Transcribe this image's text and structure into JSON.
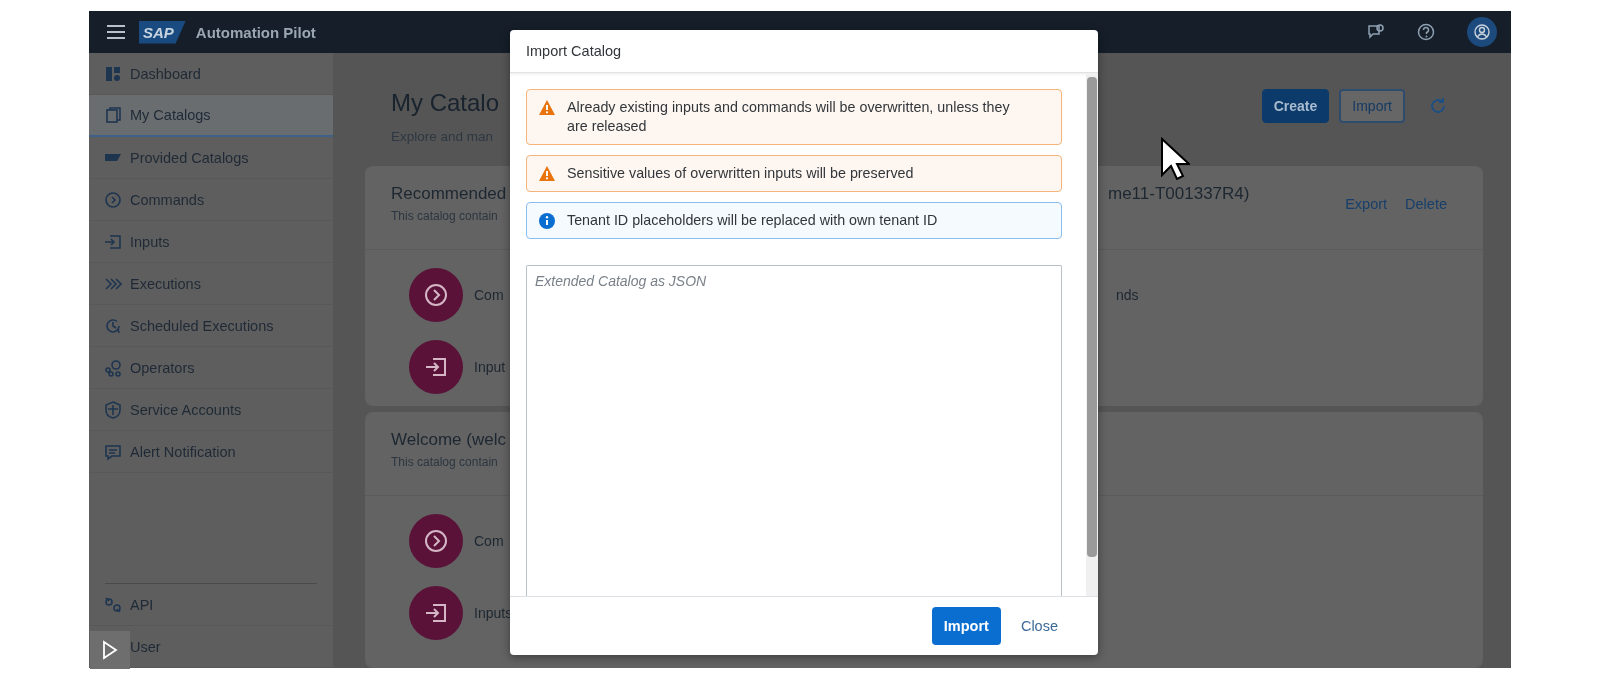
{
  "shell": {
    "logo": "SAP",
    "title": "Automation Pilot"
  },
  "sidebar": {
    "items": [
      {
        "label": "Dashboard",
        "selected": false
      },
      {
        "label": "My Catalogs",
        "selected": true
      },
      {
        "label": "Provided Catalogs",
        "selected": false
      },
      {
        "label": "Commands",
        "selected": false
      },
      {
        "label": "Inputs",
        "selected": false
      },
      {
        "label": "Executions",
        "selected": false
      },
      {
        "label": "Scheduled Executions",
        "selected": false
      },
      {
        "label": "Operators",
        "selected": false
      },
      {
        "label": "Service Accounts",
        "selected": false
      },
      {
        "label": "Alert Notification",
        "selected": false
      }
    ],
    "bottom_items": [
      {
        "label": "API",
        "selected": false
      },
      {
        "label": "User",
        "selected": false
      }
    ]
  },
  "page": {
    "title": "My Catalo",
    "subtitle": "Explore and man",
    "actions": [
      {
        "label": "Create",
        "kind": "primary"
      },
      {
        "label": "Import",
        "kind": "outline"
      }
    ]
  },
  "cards": [
    {
      "title": "Recommended",
      "title_right": "me11-T001337R4)",
      "subtitle": "This catalog contain",
      "actions": [
        "Export",
        "Delete"
      ],
      "rows": [
        {
          "kind": "command",
          "label": "Com",
          "right": "nds"
        },
        {
          "kind": "input",
          "label": "Input"
        }
      ]
    },
    {
      "title": "Welcome (welc",
      "subtitle": "This catalog contain",
      "rows": [
        {
          "kind": "command",
          "label": "Com"
        },
        {
          "kind": "input",
          "label": "Inputs"
        }
      ]
    }
  ],
  "dialog": {
    "title": "Import Catalog",
    "messages": [
      {
        "kind": "warning",
        "text": "Already existing inputs and commands will be overwritten, unless they are released"
      },
      {
        "kind": "warning",
        "text": "Sensitive values of overwritten inputs will be preserved"
      },
      {
        "kind": "information",
        "text": "Tenant ID placeholders will be replaced with own tenant ID"
      }
    ],
    "textarea": {
      "placeholder": "Extended Catalog as JSON"
    },
    "buttons": [
      {
        "label": "Import",
        "kind": "emphasized"
      },
      {
        "label": "Close",
        "kind": "transparent"
      }
    ]
  }
}
